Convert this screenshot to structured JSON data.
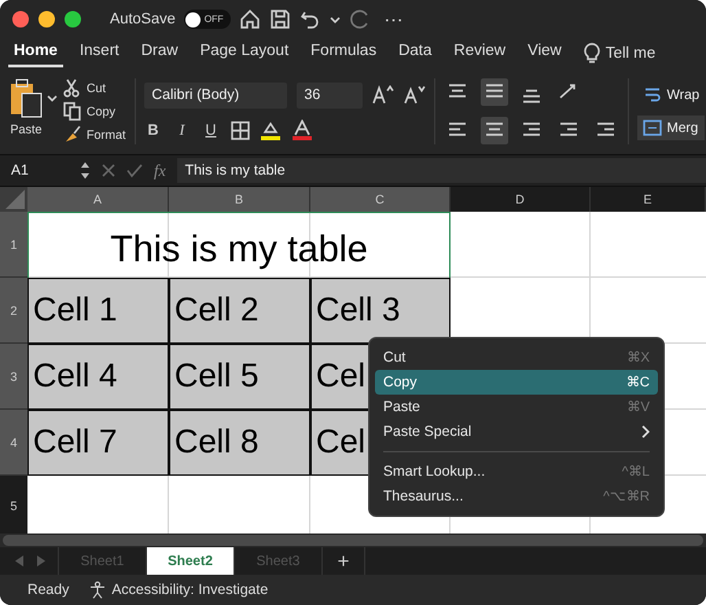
{
  "titlebar": {
    "autosave_label": "AutoSave",
    "autosave": {
      "on": false,
      "label": "OFF"
    },
    "more": "⋯"
  },
  "tabs": [
    {
      "label": "Home",
      "selected": true
    },
    {
      "label": "Insert",
      "selected": false
    },
    {
      "label": "Draw",
      "selected": false
    },
    {
      "label": "Page Layout",
      "selected": false
    },
    {
      "label": "Formulas",
      "selected": false
    },
    {
      "label": "Data",
      "selected": false
    },
    {
      "label": "Review",
      "selected": false
    },
    {
      "label": "View",
      "selected": false
    },
    {
      "label": "Tell me",
      "selected": false,
      "kind": "search"
    }
  ],
  "ribbon": {
    "paste": "Paste",
    "clipboard": [
      "Cut",
      "Copy",
      "Format"
    ],
    "font_name": "Calibri (Body)",
    "font_size": "36",
    "styles": [
      "B",
      "I",
      "U"
    ],
    "wrap": "Wrap",
    "merge": "Merg"
  },
  "formula_bar": {
    "cell_ref": "A1",
    "fx": "fx",
    "value": "This is my table"
  },
  "columns": [
    {
      "label": "A",
      "selected": true
    },
    {
      "label": "B",
      "selected": true
    },
    {
      "label": "C",
      "selected": true
    },
    {
      "label": "D",
      "selected": false
    },
    {
      "label": "E",
      "selected": false
    }
  ],
  "rows": [
    {
      "header": "1",
      "selected": true,
      "cells": [
        {
          "kind": "merged",
          "text": "This is my table"
        }
      ]
    },
    {
      "header": "2",
      "selected": true,
      "cells": [
        {
          "kind": "table",
          "text": "Cell 1"
        },
        {
          "kind": "table",
          "text": "Cell 2"
        },
        {
          "kind": "table",
          "text": "Cell 3"
        }
      ]
    },
    {
      "header": "3",
      "selected": true,
      "cells": [
        {
          "kind": "table",
          "text": "Cell 4"
        },
        {
          "kind": "table",
          "text": "Cell 5"
        },
        {
          "kind": "table",
          "text": "Cel"
        }
      ]
    },
    {
      "header": "4",
      "selected": true,
      "cells": [
        {
          "kind": "table",
          "text": "Cell 7"
        },
        {
          "kind": "table",
          "text": "Cell 8"
        },
        {
          "kind": "table",
          "text": "Cel"
        }
      ]
    },
    {
      "header": "5",
      "selected": false,
      "cells": []
    }
  ],
  "context_menu": [
    {
      "kind": "item",
      "label": "Cut",
      "shortcut": "⌘X",
      "selected": false
    },
    {
      "kind": "item",
      "label": "Copy",
      "shortcut": "⌘C",
      "selected": true
    },
    {
      "kind": "item",
      "label": "Paste",
      "shortcut": "⌘V",
      "selected": false
    },
    {
      "kind": "submenu",
      "label": "Paste Special",
      "selected": false
    },
    {
      "kind": "separator"
    },
    {
      "kind": "item",
      "label": "Smart Lookup...",
      "shortcut": "^⌘L",
      "selected": false
    },
    {
      "kind": "item",
      "label": "Thesaurus...",
      "shortcut": "^⌥⌘R",
      "selected": false
    }
  ],
  "sheets": [
    {
      "label": "Sheet1",
      "selected": false
    },
    {
      "label": "Sheet2",
      "selected": true
    },
    {
      "label": "Sheet3",
      "selected": false
    }
  ],
  "add_sheet": "+",
  "status_bar": {
    "state": "Ready",
    "accessibility": "Accessibility: Investigate"
  }
}
